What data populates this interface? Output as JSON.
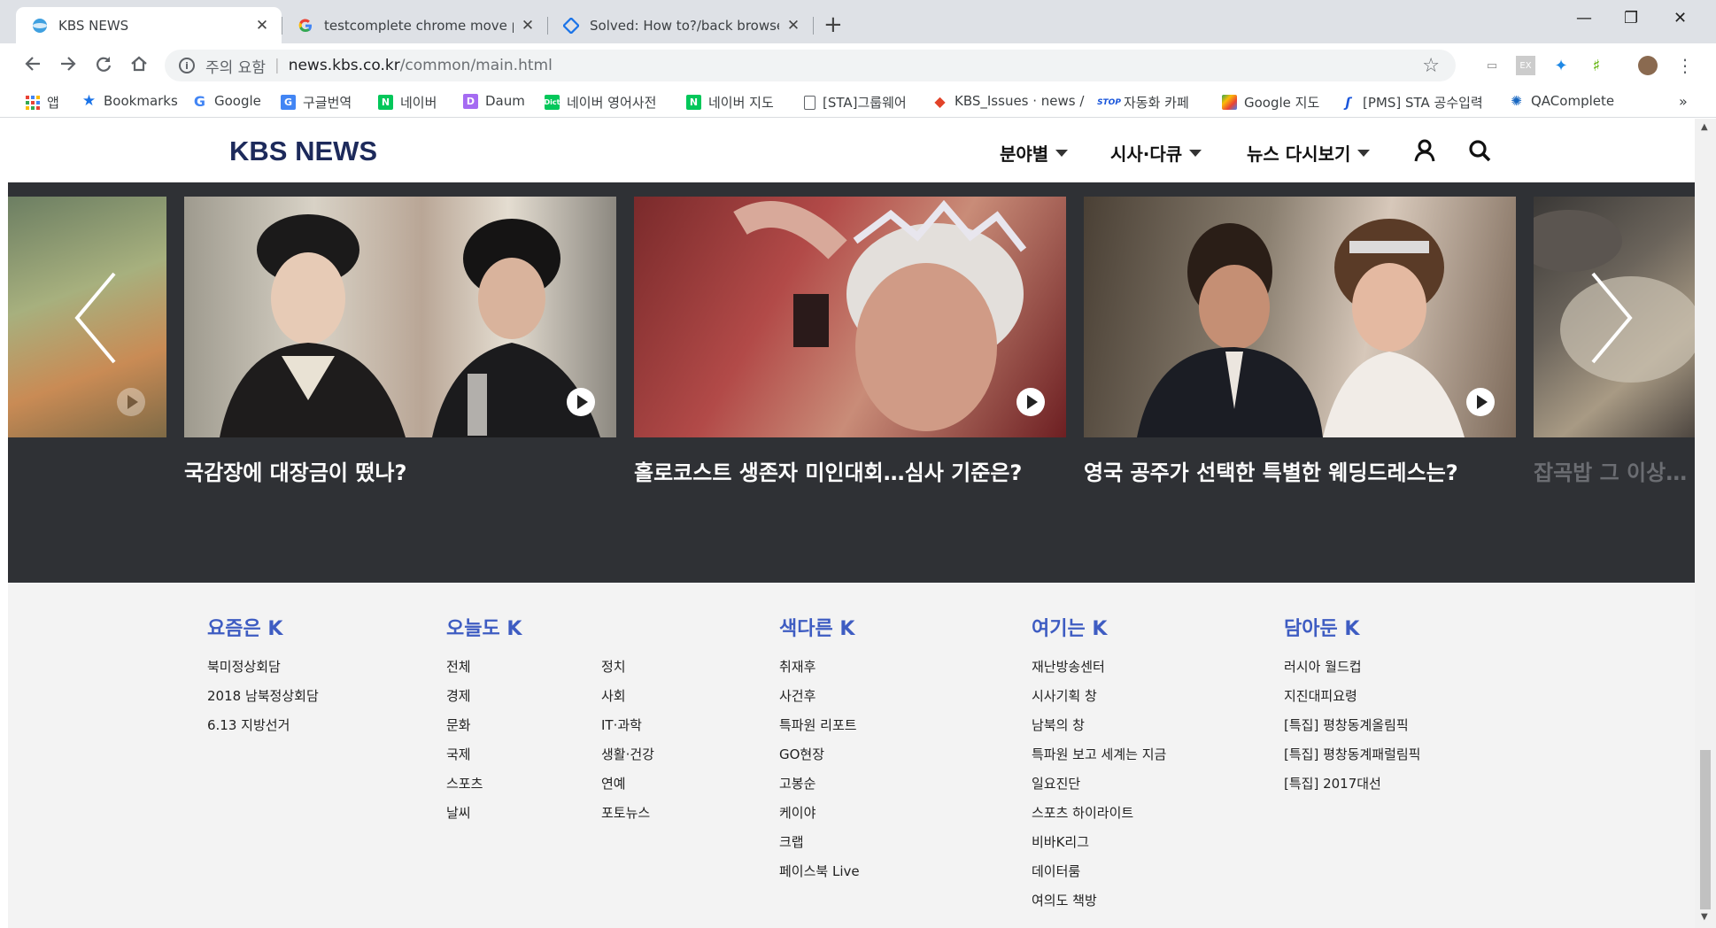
{
  "browser": {
    "tabs": [
      {
        "title": "KBS NEWS",
        "active": true
      },
      {
        "title": "testcomplete chrome move pre",
        "active": false
      },
      {
        "title": "Solved: How to?/back browser",
        "active": false
      }
    ],
    "new_tab": "+",
    "window_controls": {
      "minimize": "—",
      "restore": "❐",
      "close": "✕"
    },
    "omnibox": {
      "security_label": "주의 요함",
      "host": "news.kbs.co.kr",
      "path": "/common/main.html"
    },
    "bookmarks": [
      {
        "label": "앱",
        "icon": "apps-grid-icon"
      },
      {
        "label": "Bookmarks",
        "icon": "star-icon"
      },
      {
        "label": "Google",
        "icon": "google-icon"
      },
      {
        "label": "구글번역",
        "icon": "translate-icon"
      },
      {
        "label": "네이버",
        "icon": "naver-icon"
      },
      {
        "label": "Daum",
        "icon": "daum-icon"
      },
      {
        "label": "네이버 영어사전",
        "icon": "dict-icon"
      },
      {
        "label": "네이버 지도",
        "icon": "naver-icon"
      },
      {
        "label": "[STA]그룹웨어",
        "icon": "page-icon"
      },
      {
        "label": "KBS_Issues · news / ",
        "icon": "gitlab-icon"
      },
      {
        "label": "자동화 카페",
        "icon": "stop-icon"
      },
      {
        "label": "Google 지도",
        "icon": "maps-icon"
      },
      {
        "label": "[PMS] STA 공수입력",
        "icon": "pms-icon"
      },
      {
        "label": "QAComplete",
        "icon": "qacomplete-icon"
      }
    ],
    "bookmarks_overflow": "»"
  },
  "site": {
    "logo": "KBS NEWS",
    "menu": [
      {
        "label": "분야별"
      },
      {
        "label": "시사·다큐"
      },
      {
        "label": "뉴스 다시보기"
      }
    ]
  },
  "carousel": {
    "items": [
      {
        "caption": "국감장에 대장금이 떴나?"
      },
      {
        "caption": "홀로코스트 생존자 미인대회…심사 기준은?"
      },
      {
        "caption": "영국 공주가 선택한 특별한 웨딩드레스는?"
      },
      {
        "caption": "잡곡밥 그 이상…"
      }
    ]
  },
  "footer": {
    "columns": [
      {
        "title": "요즘은 K",
        "links": [
          "북미정상회담",
          "2018 남북정상회담",
          "6.13 지방선거"
        ]
      },
      {
        "title": "오늘도 K",
        "links": [
          "전체",
          "경제",
          "문화",
          "국제",
          "스포츠",
          "날씨"
        ],
        "links2": [
          "정치",
          "사회",
          "IT·과학",
          "생활·건강",
          "연예",
          "포토뉴스"
        ]
      },
      {
        "title": "색다른 K",
        "links": [
          "취재후",
          "사건후",
          "특파원 리포트",
          "GO현장",
          "고봉순",
          "케이야",
          "크랩",
          "페이스북 Live"
        ]
      },
      {
        "title": "여기는 K",
        "links": [
          "재난방송센터",
          "시사기획 창",
          "남북의 창",
          "특파원 보고 세계는 지금",
          "일요진단",
          "스포츠 하이라이트",
          "비바K리그",
          "데이터룸",
          "여의도 책방"
        ]
      },
      {
        "title": "담아둔 K",
        "links": [
          "러시아 월드컵",
          "지진대피요령",
          "[특집] 평창동계올림픽",
          "[특집] 평창동계패럴림픽",
          "[특집] 2017대선"
        ]
      }
    ]
  }
}
